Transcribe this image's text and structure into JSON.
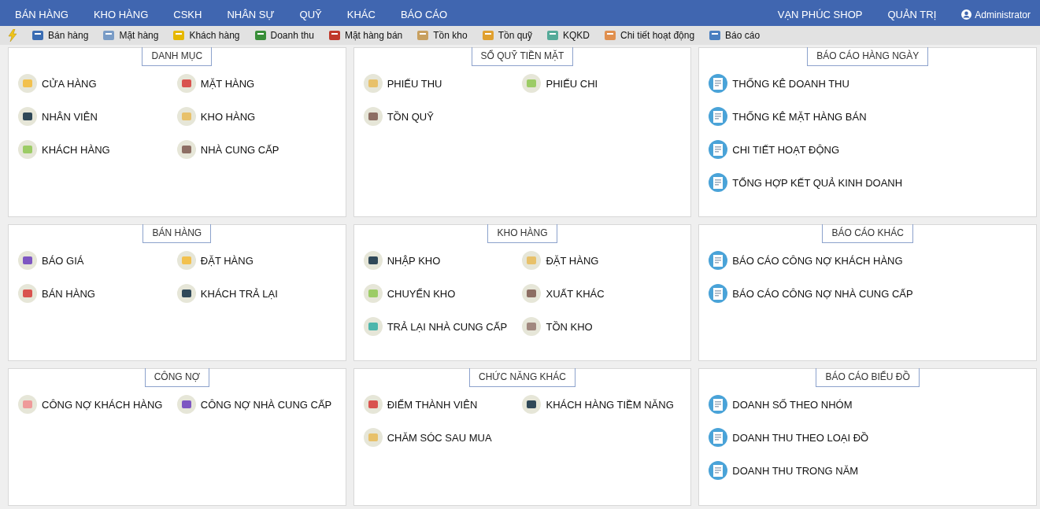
{
  "top_menu": {
    "left": [
      "BÁN HÀNG",
      "KHO HÀNG",
      "CSKH",
      "NHÂN SỰ",
      "QUỸ",
      "KHÁC",
      "BÁO CÁO"
    ],
    "right": [
      "VẠN PHÚC SHOP",
      "QUẢN TRỊ"
    ],
    "user": "Administrator"
  },
  "toolbar": [
    "Bán hàng",
    "Mặt hàng",
    "Khách hàng",
    "Doanh thu",
    "Mặt hàng bán",
    "Tồn kho",
    "Tồn quỹ",
    "KQKD",
    "Chi tiết hoạt động",
    "Báo cáo"
  ],
  "panels": [
    {
      "title": "DANH MỤC",
      "kind": "menu",
      "items": [
        "CỬA HÀNG",
        "MẶT HÀNG",
        "NHÂN VIÊN",
        "KHO HÀNG",
        "KHÁCH HÀNG",
        "NHÀ CUNG CẤP"
      ]
    },
    {
      "title": "SỔ QUỸ TIỀN MẶT",
      "kind": "menu",
      "items": [
        "PHIẾU THU",
        "PHIẾU CHI",
        "TỒN QUỸ"
      ]
    },
    {
      "title": "BÁO CÁO HÀNG NGÀY",
      "kind": "report",
      "items": [
        "THỐNG KÊ DOANH THU",
        "THỐNG KÊ MẶT HÀNG BÁN",
        "CHI TIẾT HOẠT ĐỘNG",
        "TỔNG HỢP KẾT QUẢ KINH DOANH"
      ]
    },
    {
      "title": "BÁN HÀNG",
      "kind": "menu",
      "items": [
        "BÁO GIÁ",
        "ĐẶT HÀNG",
        "BÁN HÀNG",
        "KHÁCH TRẢ LẠI"
      ]
    },
    {
      "title": "KHO HÀNG",
      "kind": "menu",
      "items": [
        "NHẬP KHO",
        "ĐẶT HÀNG",
        "CHUYỂN KHO",
        "XUẤT KHÁC",
        "TRẢ LẠI NHÀ CUNG CẤP",
        "TỒN KHO"
      ]
    },
    {
      "title": "BÁO CÁO KHÁC",
      "kind": "report",
      "items": [
        "BÁO CÁO CÔNG NỢ KHÁCH HÀNG",
        "BÁO CÁO CÔNG NỢ NHÀ CUNG CẤP"
      ]
    },
    {
      "title": "CÔNG NỢ",
      "kind": "menu",
      "items": [
        "CÔNG NỢ KHÁCH HÀNG",
        "CÔNG NỢ NHÀ CUNG CẤP"
      ]
    },
    {
      "title": "CHỨC NĂNG KHÁC",
      "kind": "menu",
      "items": [
        "ĐIỂM THÀNH VIÊN",
        "KHÁCH HÀNG TIỀM NĂNG",
        "CHĂM SÓC SAU MUA"
      ]
    },
    {
      "title": "BÁO CÁO BIỂU ĐỒ",
      "kind": "report",
      "items": [
        "DOANH SỐ THEO NHÓM",
        "DOANH THU THEO LOẠI ĐỒ",
        "DOANH THU TRONG NĂM"
      ]
    }
  ]
}
